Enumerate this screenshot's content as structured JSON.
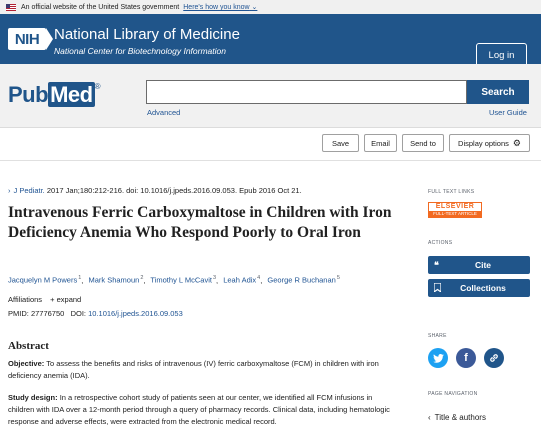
{
  "gov_banner": {
    "text": "An official website of the United States government",
    "link": "Here's how you know",
    "chevron": "⌄"
  },
  "header": {
    "logo": "NIH",
    "title": "National Library of Medicine",
    "subtitle": "National Center for Biotechnology Information",
    "login": "Log in"
  },
  "search": {
    "logo_pub": "Pub",
    "logo_med": "Med",
    "logo_reg": "®",
    "placeholder": "",
    "button": "Search",
    "advanced": "Advanced",
    "user_guide": "User Guide"
  },
  "actions": {
    "save": "Save",
    "email": "Email",
    "send_to": "Send to",
    "display_options": "Display options"
  },
  "article": {
    "citation_chevron": "›",
    "journal": "J Pediatr.",
    "citation": "2017 Jan;180:212-216. doi: 10.1016/j.jpeds.2016.09.053. Epub 2016 Oct 21.",
    "title": "Intravenous Ferric Carboxymaltose in Children with Iron Deficiency Anemia Who Respond Poorly to Oral Iron",
    "authors": [
      {
        "name": "Jacquelyn M Powers",
        "sup": "1"
      },
      {
        "name": "Mark Shamoun",
        "sup": "2"
      },
      {
        "name": "Timothy L McCavit",
        "sup": "3"
      },
      {
        "name": "Leah Adix",
        "sup": "4"
      },
      {
        "name": "George R Buchanan",
        "sup": "5"
      }
    ],
    "affiliations": "Affiliations",
    "expand": "+ expand",
    "pmid_label": "PMID:",
    "pmid": "27776750",
    "doi_label": "DOI:",
    "doi": "10.1016/j.jpeds.2016.09.053"
  },
  "abstract": {
    "heading": "Abstract",
    "objective_label": "Objective:",
    "objective": "To assess the benefits and risks of intravenous (IV) ferric carboxymaltose (FCM) in children with iron deficiency anemia (IDA).",
    "design_label": "Study design:",
    "design": "In a retrospective cohort study of patients seen at our center, we identified all FCM infusions in children with IDA over a 12-month period through a query of pharmacy records. Clinical data, including hematologic response and adverse effects, were extracted from the electronic medical record."
  },
  "sidebar": {
    "full_text_label": "FULL TEXT LINKS",
    "elsevier_top": "ELSEVIER",
    "elsevier_bottom": "FULL-TEXT ARTICLE",
    "actions_label": "ACTIONS",
    "cite": "Cite",
    "collections": "Collections",
    "share_label": "SHARE",
    "page_nav_label": "PAGE NAVIGATION",
    "title_authors": "Title & authors"
  },
  "colors": {
    "brand_blue": "#20558a",
    "link_blue": "#205493",
    "twitter": "#1da1f2",
    "facebook": "#3b5998",
    "permalink": "#20558a"
  },
  "icons": [
    "flag-icon",
    "gear-icon",
    "quote-icon",
    "bookmark-icon",
    "twitter-icon",
    "facebook-icon",
    "link-icon",
    "chevron-left-icon"
  ]
}
